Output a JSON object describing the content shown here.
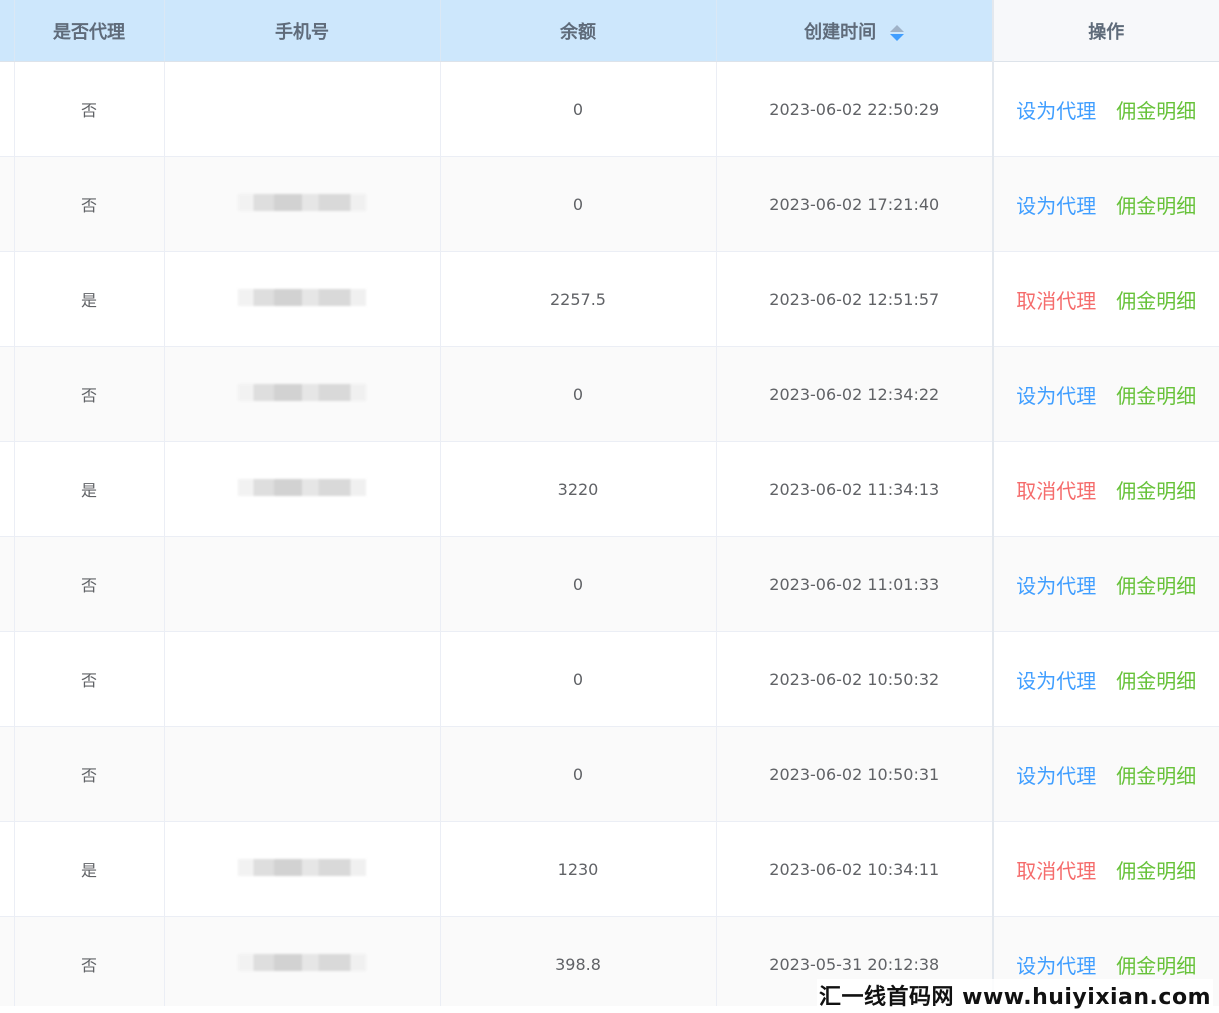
{
  "columns": {
    "is_agent": "是否代理",
    "phone": "手机号",
    "balance": "余额",
    "created_at": "创建时间",
    "actions": "操作"
  },
  "sort": {
    "column": "created_at",
    "direction": "desc"
  },
  "colors": {
    "header_bg": "#cde7fc",
    "link_blue": "#409eff",
    "link_red": "#f56c6c",
    "link_green": "#67c23a"
  },
  "rows": [
    {
      "is_agent": "否",
      "phone_masked": false,
      "balance": "0",
      "created_at": "2023-06-02 22:50:29",
      "action_primary": "设为代理",
      "action_secondary": "佣金明细",
      "action_type": "set"
    },
    {
      "is_agent": "否",
      "phone_masked": true,
      "balance": "0",
      "created_at": "2023-06-02 17:21:40",
      "action_primary": "设为代理",
      "action_secondary": "佣金明细",
      "action_type": "set"
    },
    {
      "is_agent": "是",
      "phone_masked": true,
      "balance": "2257.5",
      "created_at": "2023-06-02 12:51:57",
      "action_primary": "取消代理",
      "action_secondary": "佣金明细",
      "action_type": "cancel"
    },
    {
      "is_agent": "否",
      "phone_masked": true,
      "balance": "0",
      "created_at": "2023-06-02 12:34:22",
      "action_primary": "设为代理",
      "action_secondary": "佣金明细",
      "action_type": "set"
    },
    {
      "is_agent": "是",
      "phone_masked": true,
      "balance": "3220",
      "created_at": "2023-06-02 11:34:13",
      "action_primary": "取消代理",
      "action_secondary": "佣金明细",
      "action_type": "cancel"
    },
    {
      "is_agent": "否",
      "phone_masked": false,
      "balance": "0",
      "created_at": "2023-06-02 11:01:33",
      "action_primary": "设为代理",
      "action_secondary": "佣金明细",
      "action_type": "set"
    },
    {
      "is_agent": "否",
      "phone_masked": false,
      "balance": "0",
      "created_at": "2023-06-02 10:50:32",
      "action_primary": "设为代理",
      "action_secondary": "佣金明细",
      "action_type": "set"
    },
    {
      "is_agent": "否",
      "phone_masked": false,
      "balance": "0",
      "created_at": "2023-06-02 10:50:31",
      "action_primary": "设为代理",
      "action_secondary": "佣金明细",
      "action_type": "set"
    },
    {
      "is_agent": "是",
      "phone_masked": true,
      "balance": "1230",
      "created_at": "2023-06-02 10:34:11",
      "action_primary": "取消代理",
      "action_secondary": "佣金明细",
      "action_type": "cancel"
    },
    {
      "is_agent": "否",
      "phone_masked": true,
      "balance": "398.8",
      "created_at": "2023-05-31 20:12:38",
      "action_primary": "设为代理",
      "action_secondary": "佣金明细",
      "action_type": "set"
    }
  ],
  "watermark": "汇一线首码网 www.huiyixian.com"
}
